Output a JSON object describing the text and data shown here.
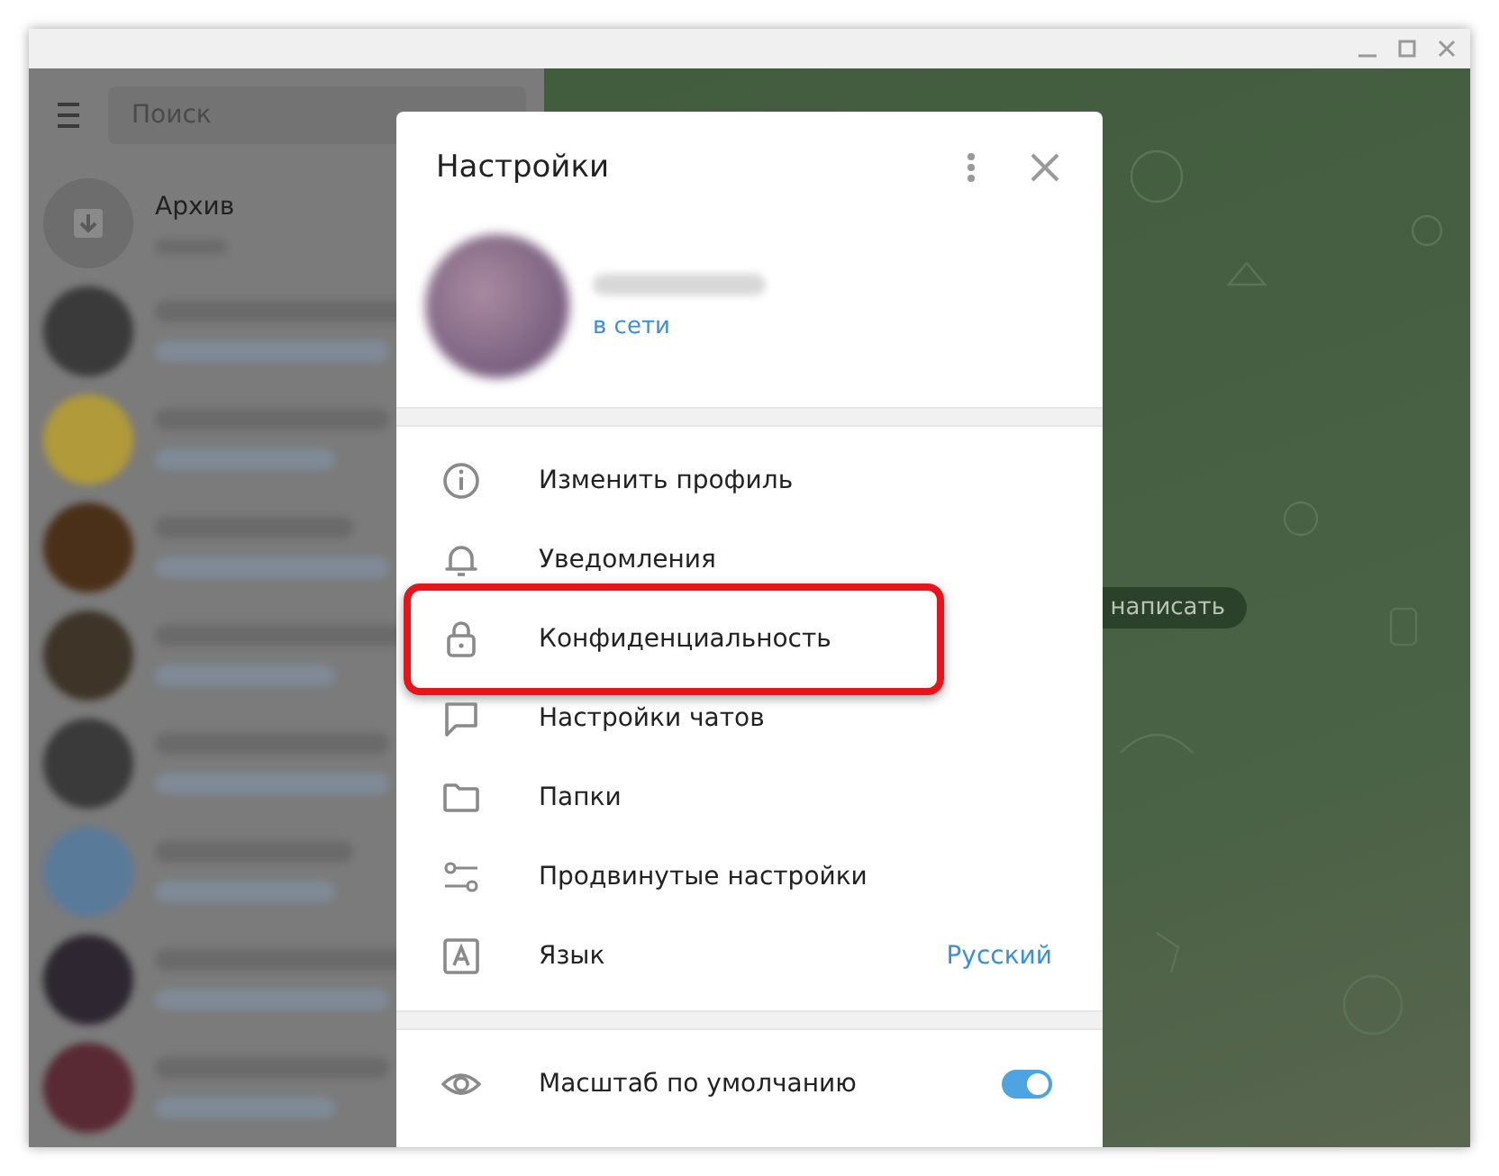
{
  "sidebar": {
    "search": {
      "placeholder": "Поиск"
    },
    "archive": {
      "title": "Архив"
    },
    "chats": [
      {
        "color": "#3a3a3a"
      },
      {
        "color": "#b09a3a"
      },
      {
        "color": "#4a3018"
      },
      {
        "color": "#3e3428"
      },
      {
        "color": "#3a3a3a"
      },
      {
        "color": "#5a7a9a"
      },
      {
        "color": "#2e2630"
      },
      {
        "color": "#5a2a34"
      }
    ]
  },
  "chat_area": {
    "hint": "написать"
  },
  "settings": {
    "title": "Настройки",
    "profile": {
      "status": "в сети"
    },
    "items": [
      {
        "label": "Изменить профиль",
        "highlighted": false
      },
      {
        "label": "Уведомления",
        "highlighted": false
      },
      {
        "label": "Конфиденциальность",
        "highlighted": true
      },
      {
        "label": "Настройки чатов",
        "highlighted": false
      },
      {
        "label": "Папки",
        "highlighted": false
      },
      {
        "label": "Продвинутые настройки",
        "highlighted": false
      },
      {
        "label": "Язык",
        "value": "Русский",
        "highlighted": false
      }
    ],
    "toggles": [
      {
        "label": "Масштаб по умолчанию",
        "on": true
      }
    ]
  }
}
